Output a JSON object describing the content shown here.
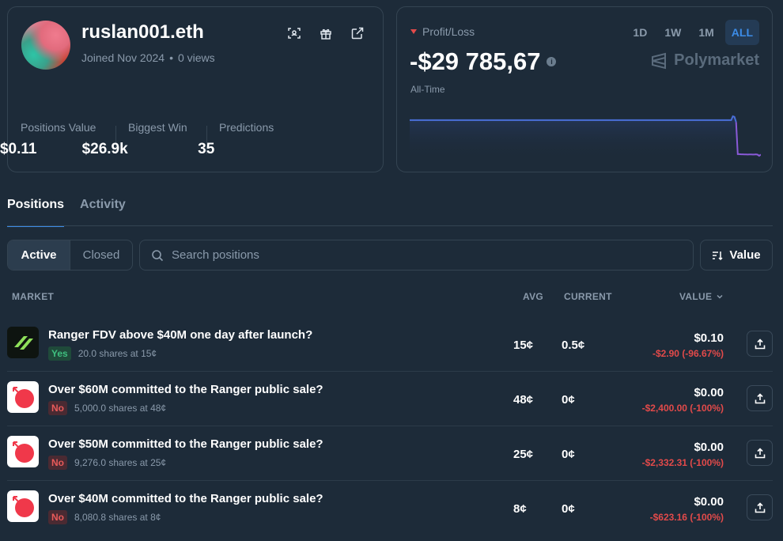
{
  "profile": {
    "username": "ruslan001.eth",
    "joined": "Joined Nov 2024",
    "views": "0 views",
    "stats": [
      {
        "label": "Positions Value",
        "value": "$0.11"
      },
      {
        "label": "Biggest Win",
        "value": "$26.9k"
      },
      {
        "label": "Predictions",
        "value": "35"
      }
    ]
  },
  "pnl": {
    "title": "Profit/Loss",
    "value": "-$29 785,67",
    "period": "All-Time",
    "ranges": [
      "1D",
      "1W",
      "1M",
      "ALL"
    ],
    "active_range": "ALL",
    "brand": "Polymarket",
    "line_color": "#4a6fd8",
    "line_color_end": "#8a5ad8",
    "series": [
      -2.0,
      -2.0,
      -2.0,
      -2.0,
      -2.0,
      -2.0,
      -2.0,
      -2.0,
      -2.0,
      -2.0,
      -2.0,
      -2.0,
      -2.0,
      -2.0,
      -2.0,
      -2.0,
      -2.0,
      -2.0,
      -2.0,
      -2.0,
      -2.0,
      -2.0,
      -2.0,
      -2.0,
      -2.0,
      -2.0,
      -2.0,
      -2.0,
      -2.0,
      -2.0,
      -2.0,
      -2.0,
      -2.0,
      -2.0,
      -2.0,
      -2.0,
      -2.0,
      -2.0,
      -2.0,
      -2.0,
      -2.0,
      -2.0,
      -2.0,
      -2.0,
      -2.0,
      -2.0,
      -2.0,
      -2.0,
      -2.0,
      -2.0,
      -2.0,
      -2.0,
      -2.0,
      -2.0,
      -2.0,
      -2.0,
      -2.0,
      -2.0,
      -2.0,
      -2.0,
      -2.0,
      -2.0,
      -2.0,
      -2.0,
      -2.0,
      -2.0,
      -2.0,
      -2.0,
      -2.0,
      -2.0,
      -2.0,
      -2.0,
      -2.0,
      -2.0,
      -2.0,
      -2.0,
      -2.0,
      -2.0,
      -2.0,
      -2.0,
      -2.0,
      -2.0,
      -2.0,
      -2.0,
      -2.0,
      -2.0,
      -2.0,
      -2.0,
      -2.0,
      -2.0,
      -2.0,
      -2.0,
      -2.0,
      -2.0,
      -2.0,
      -2.0,
      -2.0,
      -2.0,
      -2.0,
      -2.0,
      -2.0,
      -2.0,
      -2.0,
      -2.0,
      -2.0,
      -2.0,
      -2.0,
      -2.0,
      -2.0,
      -2.0,
      -2.0,
      -2.0,
      -2.0,
      -2.0,
      -2.0,
      -2.0,
      -2.0,
      -2.0,
      -2.0,
      -2.0,
      -2.0,
      -2.0,
      -2.0,
      -2.0,
      -2.0,
      -2.0,
      -2.0,
      -2.0,
      -2.0,
      -2.0,
      -2.0,
      -2.0,
      -2.0,
      -2.0,
      -2.0,
      -2.0,
      -2.0,
      -2.0,
      -2.0,
      -2.0,
      -2.0,
      -2.0,
      -2.0,
      -2.0,
      -2.0,
      -2.0,
      -2.0,
      -2.0,
      -2.0,
      -2.0,
      -2.0,
      -2.0,
      -2.0,
      -2.0,
      -2.0,
      -2.0,
      -2.0,
      -2.0,
      -2.0,
      -2.0,
      -2.0,
      -2.0,
      -2.0,
      -2.0,
      -2.0,
      -2.0,
      -2.0,
      -2.0,
      -2.0,
      -2.0,
      -2.0,
      -2.0,
      -2.0,
      -2.0,
      -2.0,
      -2.0,
      -2.0,
      -2.0,
      -2.0,
      -2.0,
      -2.0,
      -2.0,
      -2.0,
      -2.0,
      -2.0,
      -2.0,
      -2.0,
      -2.0,
      -2.0,
      -2.0,
      -2.0,
      -2.0,
      -2.0,
      -2.0,
      -2.0,
      -2.0,
      1.0,
      0.5,
      -3.5,
      -28.5,
      -28.5,
      -28.6,
      -28.6,
      -28.7,
      -28.7,
      -28.8,
      -28.7,
      -28.7,
      -28.8,
      -28.8,
      -28.6,
      -28.9,
      -29.8,
      -28.8
    ]
  },
  "tabs": [
    "Positions",
    "Activity"
  ],
  "filters": {
    "active_label": "Active",
    "closed_label": "Closed"
  },
  "search": {
    "placeholder": "Search positions"
  },
  "sort": {
    "label": "Value"
  },
  "table": {
    "headers": {
      "market": "MARKET",
      "avg": "AVG",
      "current": "CURRENT",
      "value": "VALUE"
    },
    "rows": [
      {
        "title": "Ranger FDV above $40M one day after launch?",
        "outcome": "Yes",
        "shares": "20.0 shares at 15¢",
        "avg": "15¢",
        "current": "0.5¢",
        "value": "$0.10",
        "pnl": "-$2.90 (-96.67%)",
        "icon": "ranger-logo-icon"
      },
      {
        "title": "Over $60M committed to the Ranger public sale?",
        "outcome": "No",
        "shares": "5,000.0 shares at 48¢",
        "avg": "48¢",
        "current": "0¢",
        "value": "$0.00",
        "pnl": "-$2,400.00 (-100%)",
        "icon": "ranger-sale-icon"
      },
      {
        "title": "Over $50M committed to the Ranger public sale?",
        "outcome": "No",
        "shares": "9,276.0 shares at 25¢",
        "avg": "25¢",
        "current": "0¢",
        "value": "$0.00",
        "pnl": "-$2,332.31 (-100%)",
        "icon": "ranger-sale-icon"
      },
      {
        "title": "Over $40M committed to the Ranger public sale?",
        "outcome": "No",
        "shares": "8,080.8 shares at 8¢",
        "avg": "8¢",
        "current": "0¢",
        "value": "$0.00",
        "pnl": "-$623.16 (-100%)",
        "icon": "ranger-sale-icon"
      }
    ]
  }
}
